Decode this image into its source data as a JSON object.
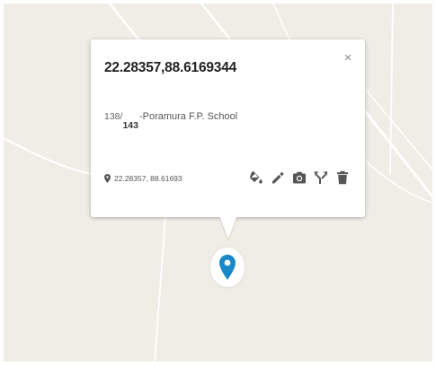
{
  "popup": {
    "title": "22.28357,88.6169344",
    "close_glyph": "×",
    "description": {
      "numerator": "138/",
      "denominator": "143",
      "name": "-Poramura F.P. School"
    },
    "coordinates": "22.28357, 88.61693",
    "coordinates_icon": "map-pin-icon",
    "tools": [
      {
        "name": "style-tool",
        "icon": "paint-bucket-icon"
      },
      {
        "name": "edit-tool",
        "icon": "pencil-icon"
      },
      {
        "name": "photo-tool",
        "icon": "camera-icon"
      },
      {
        "name": "directions-tool",
        "icon": "fork-arrows-icon"
      },
      {
        "name": "delete-tool",
        "icon": "trash-icon"
      }
    ]
  },
  "marker": {
    "icon": "location-pin-icon",
    "color": "#1a87c9"
  },
  "colors": {
    "map_background": "#efede6",
    "road": "#ffffff",
    "icon_gray": "#555555"
  }
}
